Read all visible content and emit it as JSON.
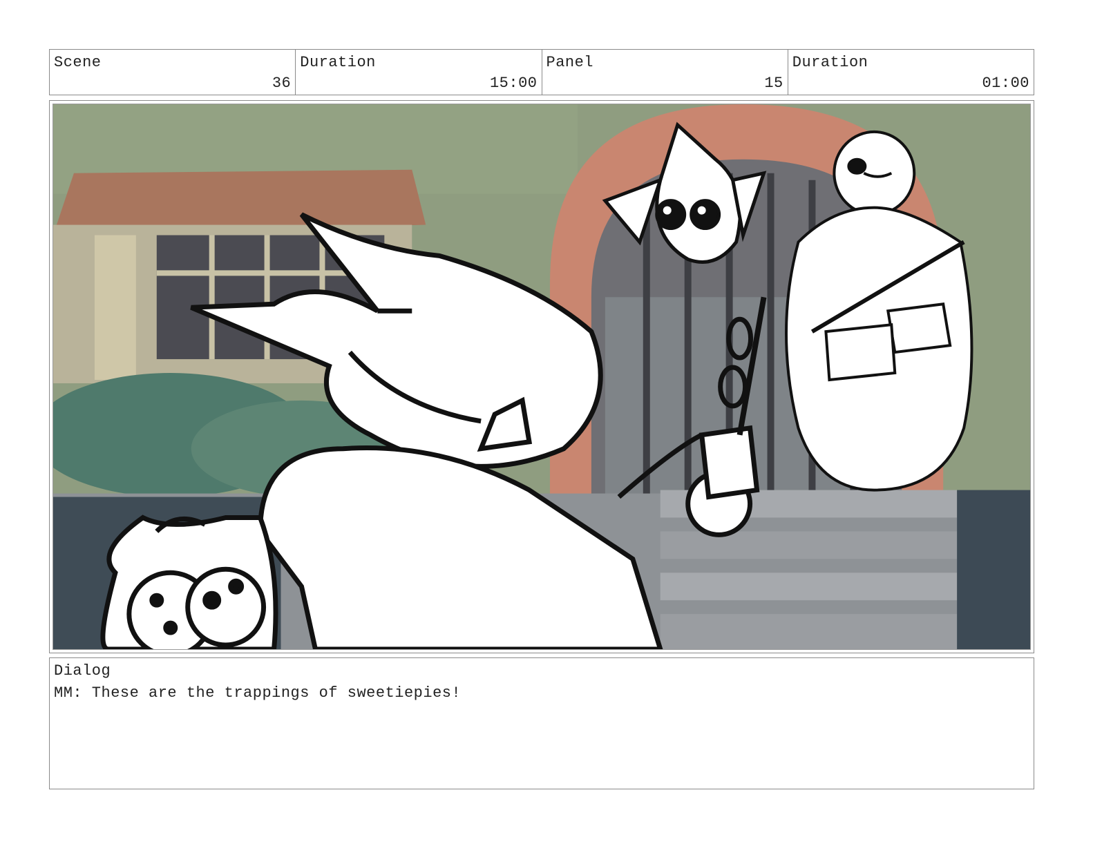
{
  "header": {
    "scene_label": "Scene",
    "scene_value": "36",
    "scene_duration_label": "Duration",
    "scene_duration_value": "15:00",
    "panel_label": "Panel",
    "panel_value": "15",
    "panel_duration_label": "Duration",
    "panel_duration_value": "01:00"
  },
  "dialog": {
    "label": "Dialog",
    "text": "MM: These are the trappings of sweetiepies!"
  },
  "colors": {
    "sky_green": "#8a9a7a",
    "roof_brown": "#a9765e",
    "arch_salmon": "#c98670",
    "stair_gray": "#8e9296",
    "door_gray": "#7f8488",
    "ink": "#111111"
  }
}
